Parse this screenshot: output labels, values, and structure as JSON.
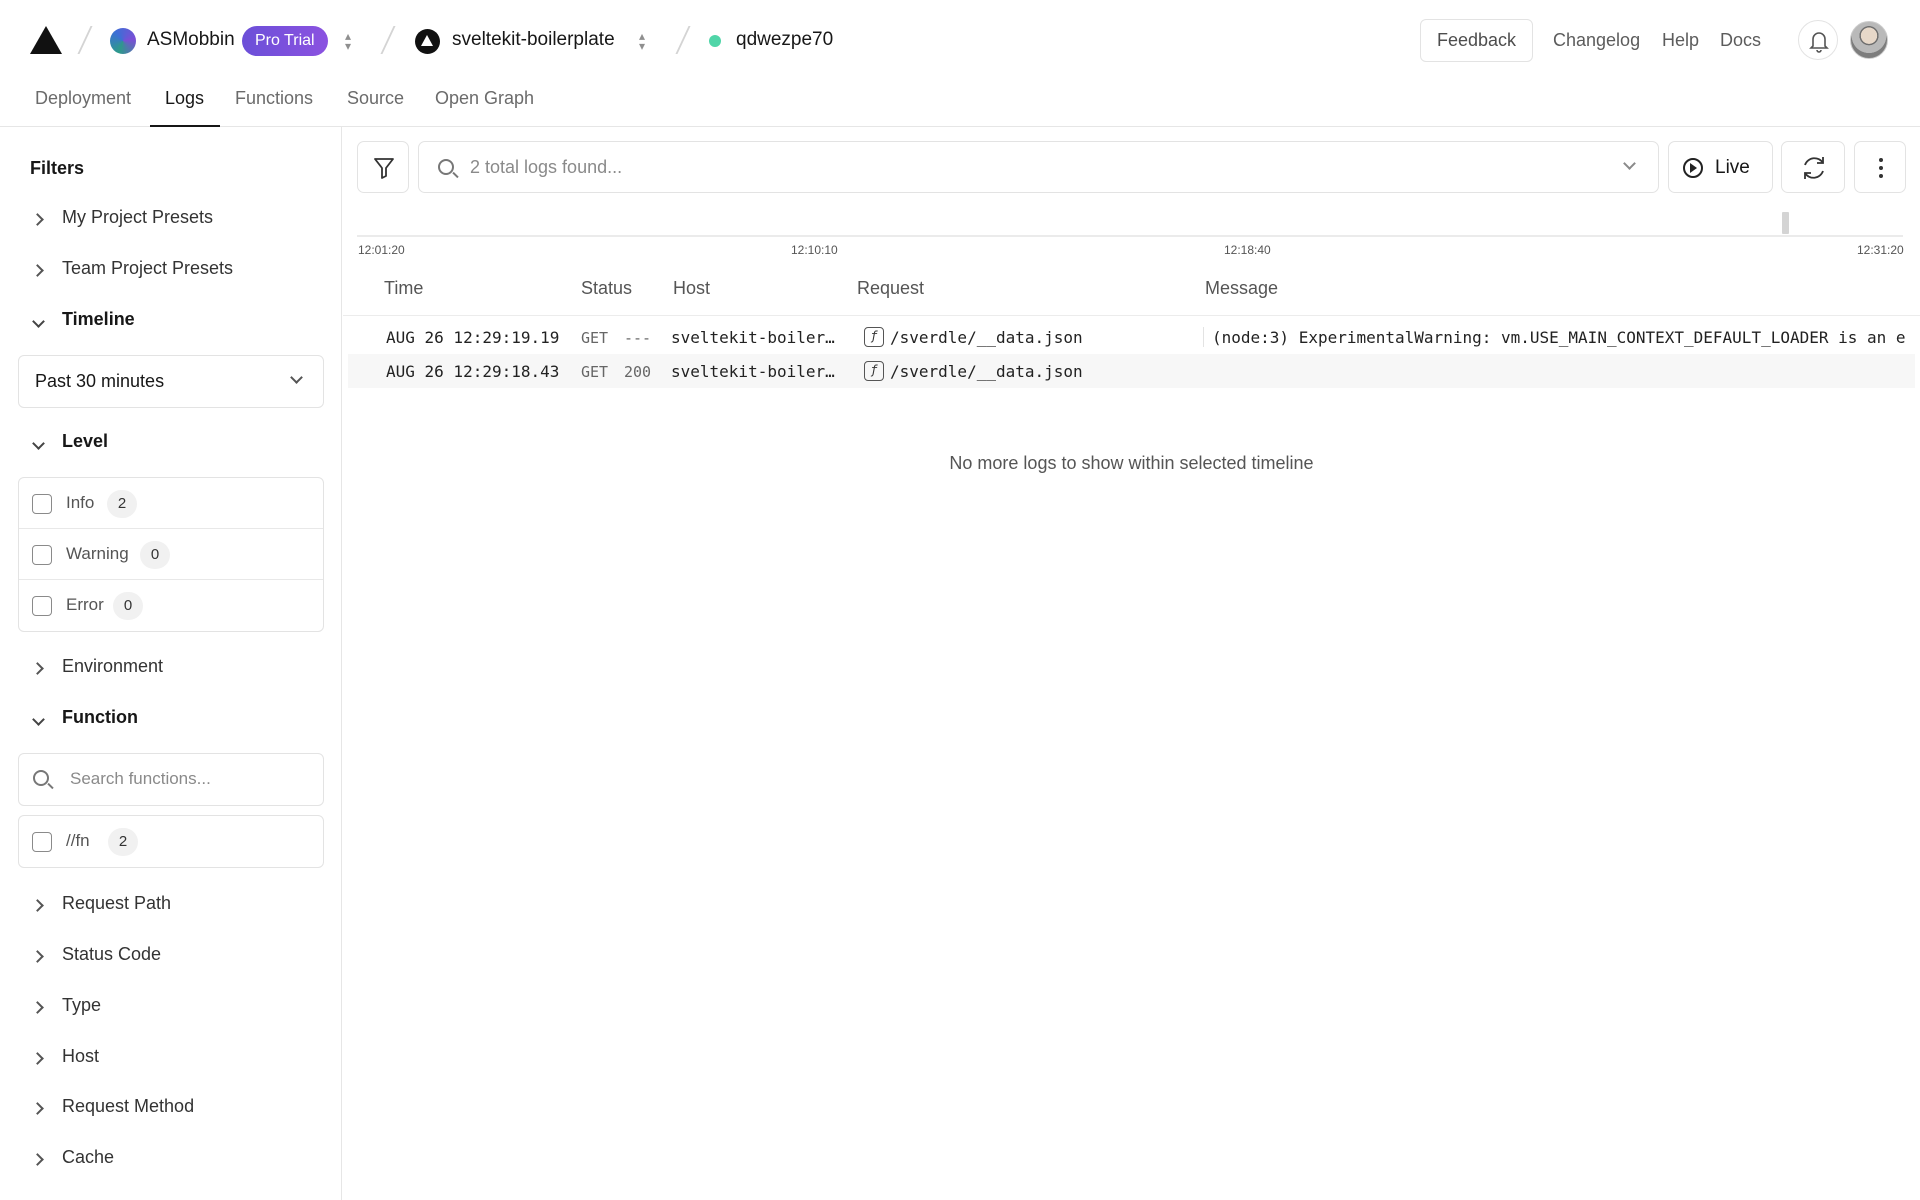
{
  "topbar": {
    "team_name": "ASMobbin",
    "plan_badge": "Pro Trial",
    "project_name": "sveltekit-boilerplate",
    "deployment_id": "qdwezpe70",
    "feedback_label": "Feedback",
    "links": [
      "Changelog",
      "Help",
      "Docs"
    ]
  },
  "tabs": [
    "Deployment",
    "Logs",
    "Functions",
    "Source",
    "Open Graph"
  ],
  "active_tab": "Logs",
  "sidebar": {
    "title": "Filters",
    "sections": {
      "my_presets": "My Project Presets",
      "team_presets": "Team Project Presets",
      "timeline": "Timeline",
      "level": "Level",
      "environment": "Environment",
      "function": "Function",
      "request_path": "Request Path",
      "status_code": "Status Code",
      "type": "Type",
      "host": "Host",
      "request_method": "Request Method",
      "cache": "Cache"
    },
    "timeline_value": "Past 30 minutes",
    "levels": [
      {
        "label": "Info",
        "count": "2"
      },
      {
        "label": "Warning",
        "count": "0"
      },
      {
        "label": "Error",
        "count": "0"
      }
    ],
    "function_search_placeholder": "Search functions...",
    "functions": [
      {
        "label": "//fn",
        "count": "2"
      }
    ]
  },
  "main": {
    "search_placeholder": "2 total logs found...",
    "live_label": "Live",
    "timeline_ticks": [
      "12:01:20",
      "12:10:10",
      "12:18:40",
      "12:31:20"
    ],
    "columns": [
      "Time",
      "Status",
      "Host",
      "Request",
      "Message"
    ],
    "rows": [
      {
        "time": "AUG 26 12:29:19.19",
        "method": "GET",
        "status": "---",
        "host": "sveltekit-boiler…",
        "request": "/sverdle/__data.json",
        "message": "(node:3) ExperimentalWarning: vm.USE_MAIN_CONTEXT_DEFAULT_LOADER is an e"
      },
      {
        "time": "AUG 26 12:29:18.43",
        "method": "GET",
        "status": "200",
        "host": "sveltekit-boiler…",
        "request": "/sverdle/__data.json",
        "message": ""
      }
    ],
    "empty_message": "No more logs to show within selected timeline"
  }
}
